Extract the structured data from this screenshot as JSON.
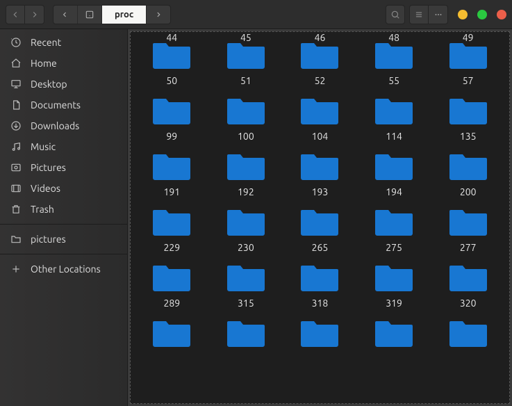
{
  "path": {
    "current": "proc"
  },
  "sidebar": {
    "items": [
      {
        "icon": "recent",
        "label": "Recent"
      },
      {
        "icon": "home",
        "label": "Home"
      },
      {
        "icon": "desktop",
        "label": "Desktop"
      },
      {
        "icon": "documents",
        "label": "Documents"
      },
      {
        "icon": "downloads",
        "label": "Downloads"
      },
      {
        "icon": "music",
        "label": "Music"
      },
      {
        "icon": "pictures",
        "label": "Pictures"
      },
      {
        "icon": "videos",
        "label": "Videos"
      },
      {
        "icon": "trash",
        "label": "Trash"
      }
    ],
    "bookmarks": [
      {
        "icon": "folder",
        "label": "pictures"
      }
    ],
    "other": {
      "icon": "plus",
      "label": "Other Locations"
    }
  },
  "grid": {
    "partial_row_labels": [
      "44",
      "45",
      "46",
      "48",
      "49"
    ],
    "folders": [
      "50",
      "51",
      "52",
      "55",
      "57",
      "99",
      "100",
      "104",
      "114",
      "135",
      "191",
      "192",
      "193",
      "194",
      "200",
      "229",
      "230",
      "265",
      "275",
      "277",
      "289",
      "315",
      "318",
      "319",
      "320",
      "",
      "",
      "",
      "",
      ""
    ]
  }
}
